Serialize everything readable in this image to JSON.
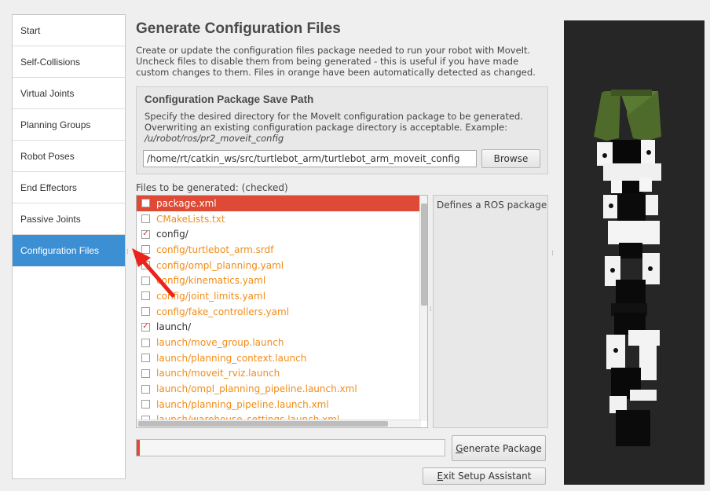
{
  "sidebar": {
    "items": [
      {
        "label": "Start"
      },
      {
        "label": "Self-Collisions"
      },
      {
        "label": "Virtual Joints"
      },
      {
        "label": "Planning Groups"
      },
      {
        "label": "Robot Poses"
      },
      {
        "label": "End Effectors"
      },
      {
        "label": "Passive Joints"
      },
      {
        "label": "Configuration Files"
      }
    ],
    "active_index": 7
  },
  "main": {
    "title": "Generate Configuration Files",
    "description": "Create or update the configuration files package needed to run your robot with MoveIt. Uncheck files to disable them from being generated - this is useful if you have made custom changes to them. Files in orange have been automatically detected as changed.",
    "save_path": {
      "title": "Configuration Package Save Path",
      "description": "Specify the desired directory for the MoveIt configuration package to be generated. Overwriting an existing configuration package directory is acceptable. Example:",
      "example": "/u/robot/ros/pr2_moveit_config",
      "value": "/home/rt/catkin_ws/src/turtlebot_arm/turtlebot_arm_moveit_config",
      "browse_label": "Browse"
    },
    "files_label": "Files to be generated: (checked)",
    "files": [
      {
        "name": "package.xml",
        "checked": false,
        "changed": true,
        "selected": true
      },
      {
        "name": "CMakeLists.txt",
        "checked": false,
        "changed": true
      },
      {
        "name": "config/",
        "checked": true,
        "changed": false
      },
      {
        "name": "config/turtlebot_arm.srdf",
        "checked": false,
        "changed": true
      },
      {
        "name": "config/ompl_planning.yaml",
        "checked": false,
        "changed": true
      },
      {
        "name": "config/kinematics.yaml",
        "checked": false,
        "changed": true
      },
      {
        "name": "config/joint_limits.yaml",
        "checked": false,
        "changed": true
      },
      {
        "name": "config/fake_controllers.yaml",
        "checked": false,
        "changed": true
      },
      {
        "name": "launch/",
        "checked": true,
        "changed": false
      },
      {
        "name": "launch/move_group.launch",
        "checked": false,
        "changed": true
      },
      {
        "name": "launch/planning_context.launch",
        "checked": false,
        "changed": true
      },
      {
        "name": "launch/moveit_rviz.launch",
        "checked": false,
        "changed": true
      },
      {
        "name": "launch/ompl_planning_pipeline.launch.xml",
        "checked": false,
        "changed": true
      },
      {
        "name": "launch/planning_pipeline.launch.xml",
        "checked": false,
        "changed": true
      },
      {
        "name": "launch/warehouse_settings.launch.xml",
        "checked": false,
        "changed": true
      }
    ],
    "file_description": "Defines a ROS package",
    "progress": 0.01,
    "generate_label_prefix": "G",
    "generate_label_rest": "enerate Package",
    "exit_label_prefix": "E",
    "exit_label_rest": "xit Setup Assistant"
  },
  "colors": {
    "accent": "#3d8fd3",
    "changed_file": "#f28c19",
    "selected_row": "#de4a35",
    "annotation_arrow": "#e8241b",
    "gripper": "#4e6b2c"
  },
  "icons": {
    "checkbox_checked": "check-mark-icon",
    "annotation": "red-arrow-icon"
  }
}
